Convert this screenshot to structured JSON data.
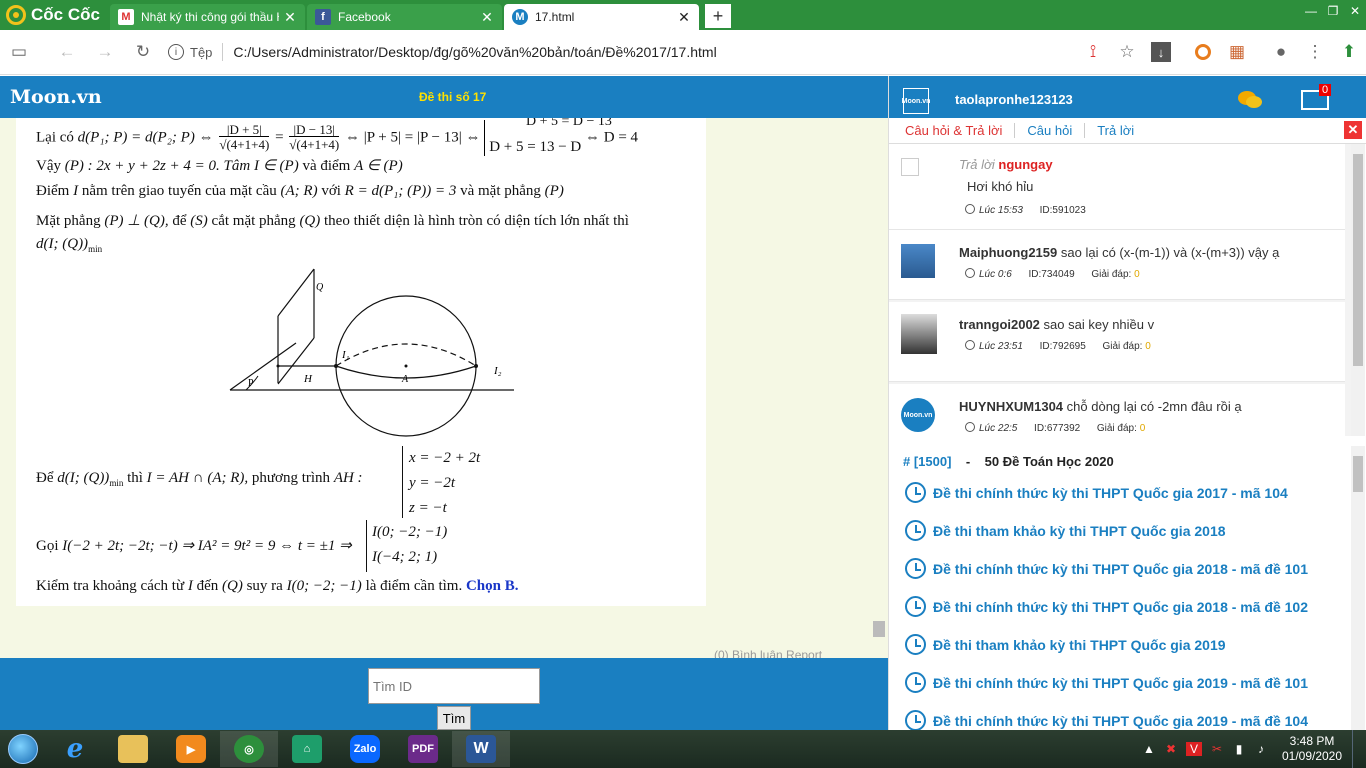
{
  "browser": {
    "brand": "Cốc Cốc",
    "tabs": [
      {
        "label": "Nhật ký thi công gói thầu Ho",
        "icon": "gmail-icon",
        "active": false
      },
      {
        "label": "Facebook",
        "icon": "facebook-icon",
        "active": false
      },
      {
        "label": "17.html",
        "icon": "moon-icon",
        "active": true
      }
    ],
    "address_label": "Tệp",
    "url": "C:/Users/Administrator/Desktop/đg/gõ%20văn%20bản/toán/Đề%2017/17.html"
  },
  "header": {
    "logo": "Moon.vn",
    "title": "Đề thi số 17"
  },
  "solution": {
    "line1_start": "Lại có",
    "line2": "Vậy",
    "line2_b": "(P) : 2x + y + 2z + 4 = 0. Tâm",
    "line2_c": "I ∈ (P)",
    "line2_d": "và điểm",
    "line2_e": "A ∈ (P)",
    "line3": "Điểm",
    "line3_b": "I",
    "line3_c": "nằm trên giao tuyến của mặt cầu",
    "line3_d": "(A; R)",
    "line3_e": "với",
    "line3_f": "R = d(P₁; (P)) = 3",
    "line3_g": "và mặt phẳng",
    "line3_h": "(P)",
    "line4": "Mặt phẳng",
    "line4_b": "(P) ⊥ (Q),",
    "line4_c": "để",
    "line4_d": "(S)",
    "line4_e": "cắt mặt phẳng",
    "line4_f": "(Q)",
    "line4_g": "theo thiết diện là hình tròn có diện tích lớn nhất thì",
    "line5": "d(I; (Q))",
    "line5_sub": "min",
    "line6": "Để",
    "line6_b": "d(I; (Q))",
    "line6_sub": "min",
    "line6_c": "thì",
    "line6_d": "I = AH ∩ (A; R),",
    "line6_e": "phương trình",
    "line6_f": "AH :",
    "sys_x": "x = −2 + 2t",
    "sys_y": "y = −2t",
    "sys_z": "z = −t",
    "line7": "Gọi",
    "line7_b": "I(−2 + 2t; −2t; −t) ⇒ IA² = 9t² = 9 ⇔ t = ±1 ⇒",
    "sol1": "I(0; −2; −1)",
    "sol2": "I(−4; 2; 1)",
    "line8": "Kiểm tra khoảng cách từ",
    "line8_b": "I",
    "line8_c": "đến",
    "line8_d": "(Q)",
    "line8_e": "suy ra",
    "line8_f": "I(0; −2; −1)",
    "line8_g": "là điểm cần tìm.",
    "line8_answer": "Chọn B.",
    "figure": {
      "Q": "Q",
      "P": "P",
      "H": "H",
      "A": "A",
      "I1": "I₁",
      "I2": "I₂"
    },
    "partial_top": "D + 5 = D − 13",
    "partial_eq_left": "d(P₁; P) = d(P₂; P) ⇔",
    "partial_num1": "|D + 5|",
    "partial_den1": "√(4+1+4)",
    "partial_num2": "|D − 13|",
    "partial_den2": "√(4+1+4)",
    "partial_mid": "⇔ |P + 5| = |P − 13| ⇔",
    "partial_case2": "D + 5 = 13 − D",
    "partial_res": "⇔ D = 4"
  },
  "footer_links": "(0) Bình luận   Report",
  "search": {
    "placeholder": "Tìm ID",
    "button": "Tìm"
  },
  "panel": {
    "username": "taolapronhe123123",
    "mail_count": "0",
    "avatar_text": "Moon.vn",
    "tabs": [
      "Câu hỏi & Trả lời",
      "Câu hỏi",
      "Trả lời"
    ],
    "close": "✕",
    "qa": [
      {
        "prefix": "Trả lời",
        "user": "ngungay",
        "text": "Hơi khó hỉu",
        "time": "Lúc 15:53",
        "id": "ID:591023",
        "answers": ""
      },
      {
        "prefix": "",
        "user": "Maiphuong2159",
        "text": "sao lại có (x-(m-1)) và (x-(m+3)) vậy ạ",
        "time": "Lúc 0:6",
        "id": "ID:734049",
        "answers_label": "Giải đáp:",
        "answers": "0"
      },
      {
        "prefix": "",
        "user": "tranngoi2002",
        "text": "sao sai key nhiều v",
        "time": "Lúc 23:51",
        "id": "ID:792695",
        "answers_label": "Giải đáp:",
        "answers": "0"
      },
      {
        "prefix": "",
        "user": "HUYNHXUM1304",
        "text": "chỗ dòng lại có -2mn đâu rồi ạ",
        "time": "Lúc 22:5",
        "id": "ID:677392",
        "answers_label": "Giải đáp:",
        "answers": "0"
      }
    ],
    "exam_id": "# [1500]",
    "exam_sep": "-",
    "exam_title": "50 Đề Toán Học 2020",
    "exams": [
      "Đề thi chính thức kỳ thi THPT Quốc gia 2017 - mã 104",
      "Đề thi tham khảo kỳ thi THPT Quốc gia 2018",
      "Đề thi chính thức kỳ thi THPT Quốc gia 2018 - mã đề 101",
      "Đề thi chính thức kỳ thi THPT Quốc gia 2018 - mã đề 102",
      "Đề thi tham khảo kỳ thi THPT Quốc gia 2019",
      "Đề thi chính thức kỳ thi THPT Quốc gia 2019 - mã đề 101",
      "Đề thi chính thức kỳ thi THPT Quốc gia 2019 - mã đề 104"
    ]
  },
  "taskbar": {
    "apps": [
      "ie-icon",
      "explorer-icon",
      "media-icon",
      "coccoc-icon",
      "app-icon",
      "Zalo",
      "PDF",
      "W"
    ],
    "time": "3:48 PM",
    "date": "01/09/2020"
  }
}
